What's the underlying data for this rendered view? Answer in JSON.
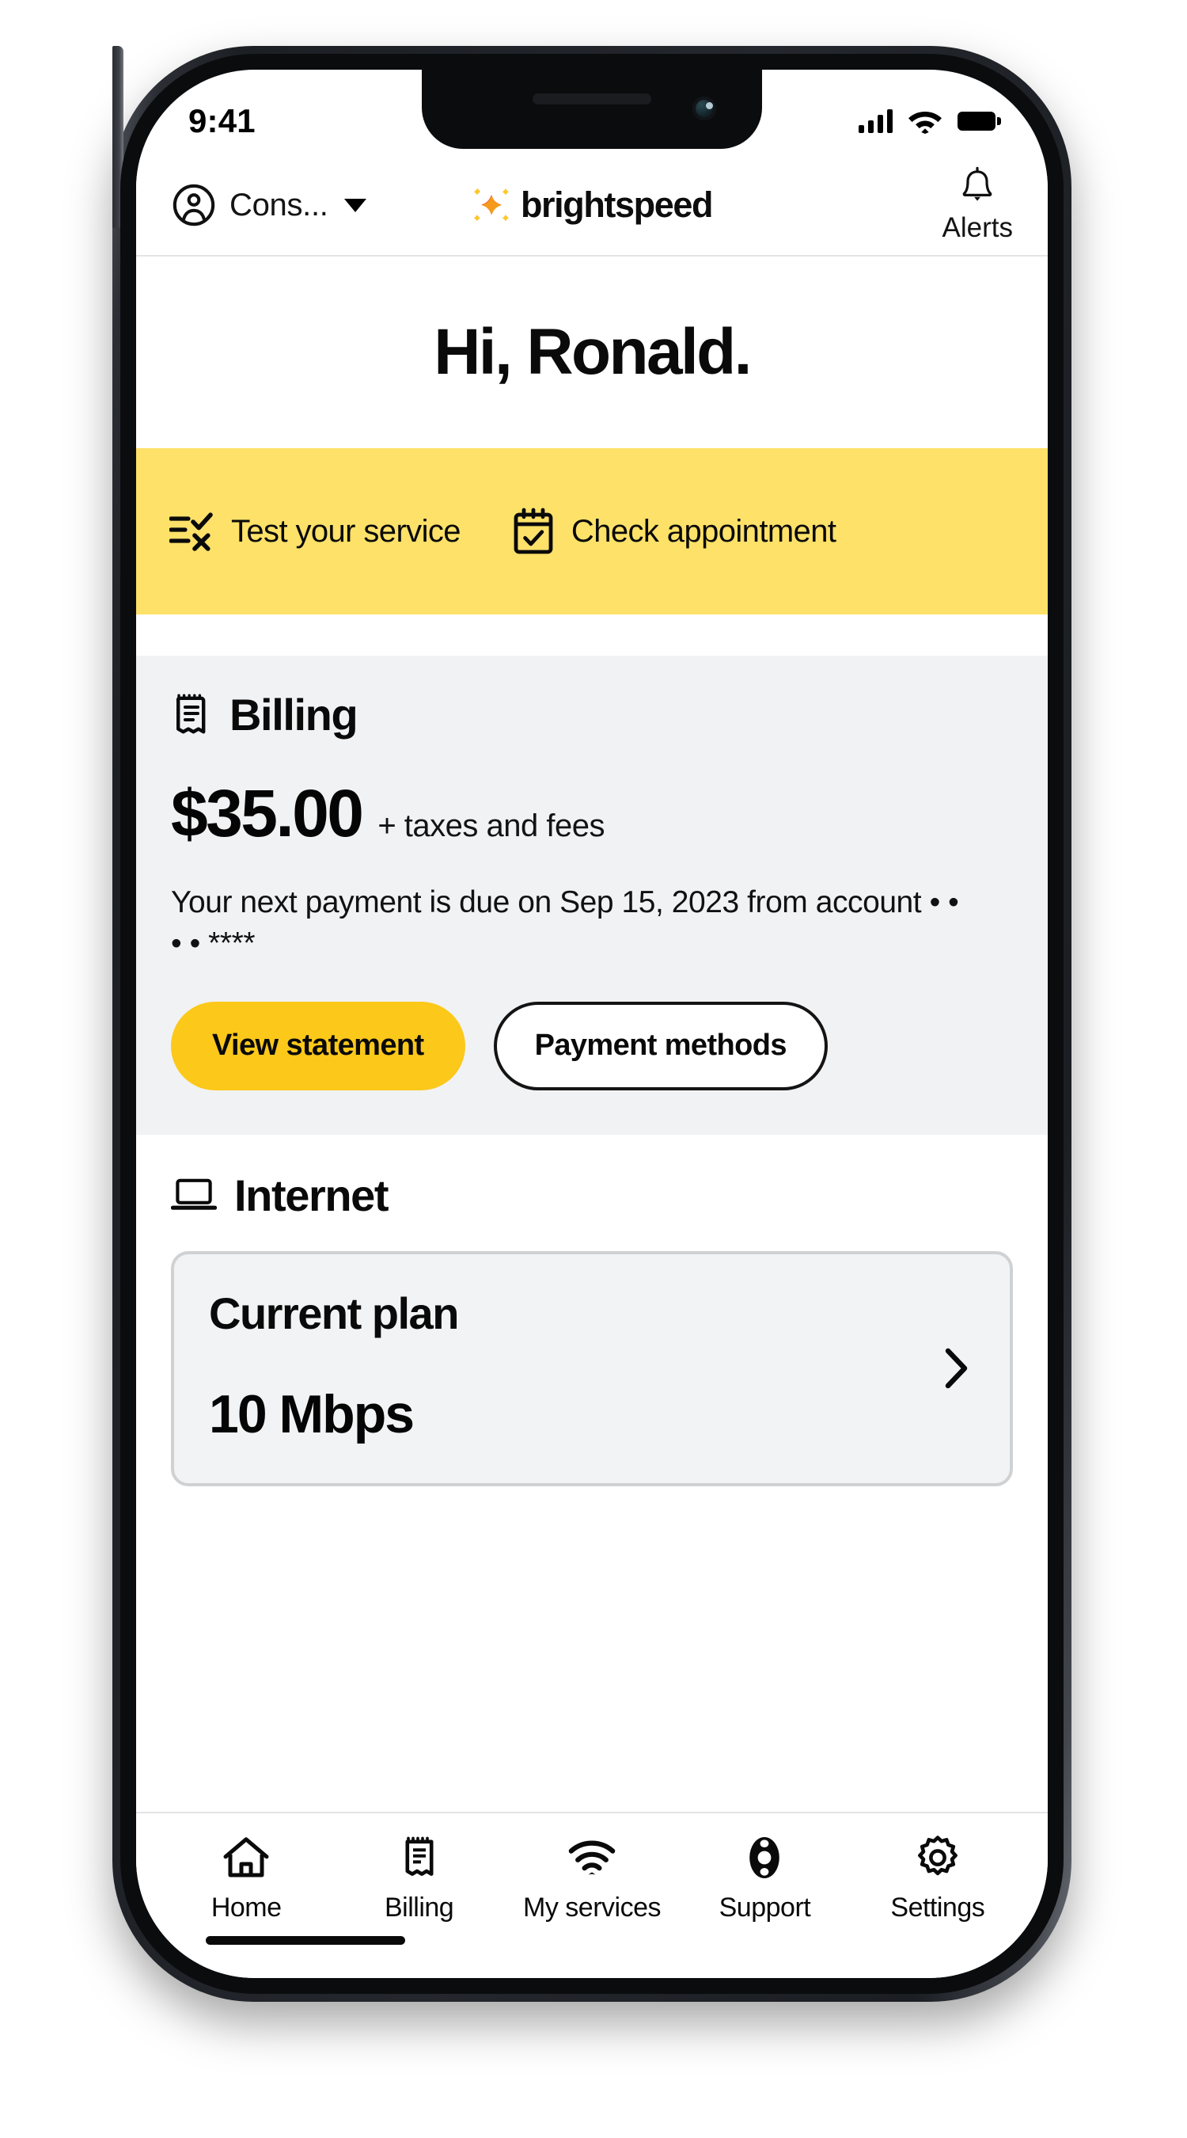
{
  "status_bar": {
    "time": "9:41",
    "signal_icon": "cellular-signal-icon",
    "wifi_icon": "wifi-icon",
    "battery_icon": "battery-full-icon"
  },
  "header": {
    "account_icon": "account-circle-icon",
    "account_name": "Cons...",
    "dropdown_icon": "chevron-down-icon",
    "brand_mark_icon": "brightspeed-logo-icon",
    "brand_name": "brightspeed",
    "alerts_icon": "bell-icon",
    "alerts_label": "Alerts"
  },
  "greeting": {
    "text": "Hi, Ronald."
  },
  "quick_actions": {
    "background_color": "#FEE169",
    "items": [
      {
        "label": "Test your service",
        "icon": "speed-test-icon"
      },
      {
        "label": "Check appointment",
        "icon": "calendar-check-icon"
      }
    ]
  },
  "billing": {
    "icon": "receipt-icon",
    "title": "Billing",
    "amount": "$35.00",
    "amount_note": "+ taxes and fees",
    "due_text": "Your next payment is due on Sep 15, 2023 from account • • • • ****",
    "primary_button": {
      "label": "View statement",
      "color": "#FCC81A"
    },
    "secondary_button": {
      "label": "Payment methods",
      "color": "#FFFFFF"
    }
  },
  "internet": {
    "icon": "laptop-icon",
    "title": "Internet",
    "plan_card": {
      "title": "Current plan",
      "value": "10 Mbps",
      "chevron_icon": "chevron-right-icon"
    }
  },
  "bottom_nav": {
    "items": [
      {
        "label": "Home",
        "icon": "home-icon",
        "active": true
      },
      {
        "label": "Billing",
        "icon": "receipt-icon",
        "active": false
      },
      {
        "label": "My services",
        "icon": "wifi-icon",
        "active": false
      },
      {
        "label": "Support",
        "icon": "lifebuoy-icon",
        "active": false
      },
      {
        "label": "Settings",
        "icon": "gear-icon",
        "active": false
      }
    ]
  }
}
